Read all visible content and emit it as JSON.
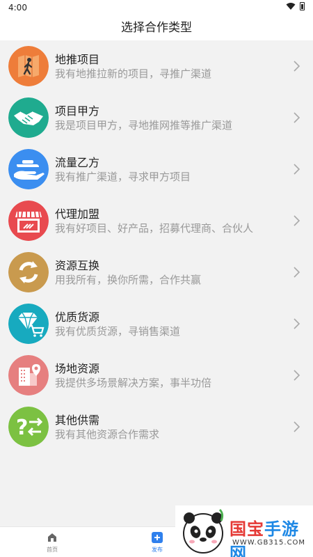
{
  "status_bar": {
    "time": "4:00"
  },
  "header": {
    "title": "选择合作类型"
  },
  "items": [
    {
      "title": "地推项目",
      "desc": "我有地推拉新的项目，寻推广渠道",
      "icon": "walking-person-icon",
      "color": "#ee7d3a"
    },
    {
      "title": "项目甲方",
      "desc": "我是项目甲方，寻地推网推等推广渠道",
      "icon": "handshake-icon",
      "color": "#1fab8f"
    },
    {
      "title": "流量乙方",
      "desc": "我有推广渠道，寻求甲方项目",
      "icon": "hand-platform-icon",
      "color": "#3b8ef0"
    },
    {
      "title": "代理加盟",
      "desc": "我有好项目、好产品，招募代理商、合伙人",
      "icon": "storefront-icon",
      "color": "#e84a4f"
    },
    {
      "title": "资源互换",
      "desc": "用我所有，换你所需，合作共赢",
      "icon": "exchange-arrows-icon",
      "color": "#c99a4e"
    },
    {
      "title": "优质货源",
      "desc": "我有优质货源，寻销售渠道",
      "icon": "diamond-cart-icon",
      "color": "#17aabf"
    },
    {
      "title": "场地资源",
      "desc": "我提供多场景解决方案，事半功倍",
      "icon": "building-map-icon",
      "color": "#e67f7f"
    },
    {
      "title": "其他供需",
      "desc": "我有其他资源合作需求",
      "icon": "question-exchange-icon",
      "color": "#7cc142"
    }
  ],
  "bottom_nav": {
    "home_label": "首页",
    "post_label": "发布"
  },
  "watermark": {
    "brand_part1": "国宝",
    "brand_part2": "手游网",
    "url": "WWW.GB315.COM"
  }
}
